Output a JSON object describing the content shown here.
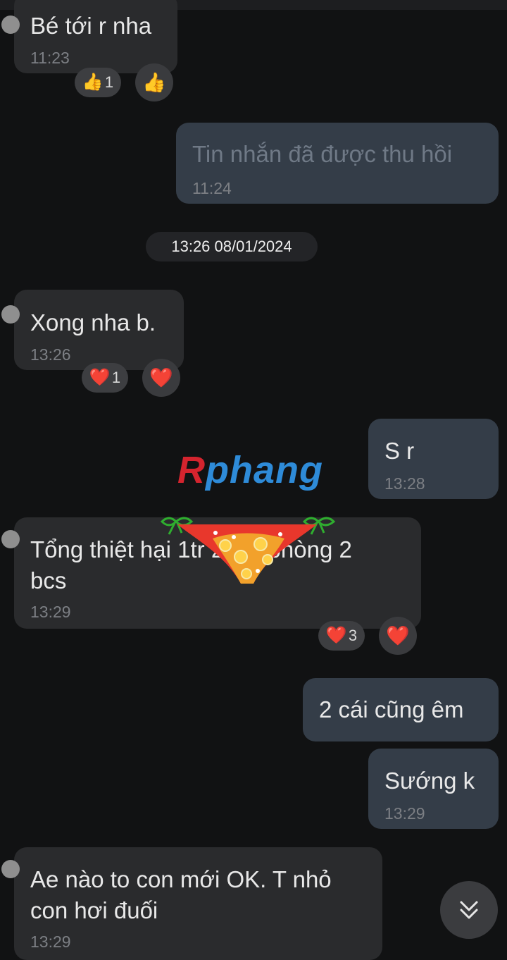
{
  "messages": [
    {
      "text": "Bé tới r nha",
      "time": "11:23"
    },
    {
      "text": "Tin nhắn đã được thu hồi",
      "time": "11:24"
    },
    {
      "text": "Xong nha b.",
      "time": "13:26"
    },
    {
      "text": "S r",
      "time": "13:28"
    },
    {
      "line1": "Tổng thiệt hại 1tr 200k phòng 2",
      "line2": "bcs",
      "time": "13:29"
    },
    {
      "text": "2 cái cũng êm"
    },
    {
      "text": "Sướng k",
      "time": "13:29"
    },
    {
      "line1": "Ae nào to con mới OK. T nhỏ",
      "line2": "con hơi đuối",
      "time": "13:29"
    }
  ],
  "date_separator": "13:26 08/01/2024",
  "reactions": {
    "msg1": {
      "emoji": "👍",
      "count": "1",
      "button_emoji": "👍"
    },
    "msg3": {
      "emoji": "❤️",
      "count": "1",
      "button_emoji": "❤️"
    },
    "msg5": {
      "emoji": "❤️",
      "count": "3",
      "button_emoji": "❤️"
    }
  },
  "watermark": {
    "part1": "R",
    "part2": "phang"
  },
  "icons": {
    "scroll_down": "double-chevron-down-icon"
  },
  "colors": {
    "background": "#111213",
    "incoming_bubble": "#2a2b2d",
    "outgoing_bubble": "#343d48",
    "timestamp": "#7c7f84"
  }
}
